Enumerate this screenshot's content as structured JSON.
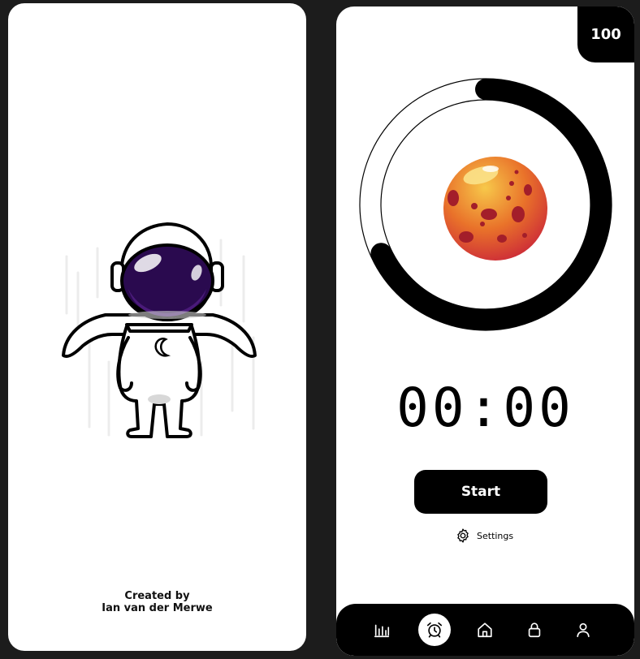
{
  "splash": {
    "credit_line1": "Created by",
    "credit_line2": "Ian van der Merwe",
    "illustration": "astronaut-with-cape"
  },
  "timer": {
    "score": "100",
    "progress": 0.68,
    "planet": "mars-planet",
    "time": "00:00",
    "start_label": "Start",
    "settings_label": "Settings"
  },
  "nav": {
    "items": [
      {
        "icon": "chart-icon",
        "active": false
      },
      {
        "icon": "alarm-clock-icon",
        "active": true
      },
      {
        "icon": "home-icon",
        "active": false
      },
      {
        "icon": "lock-icon",
        "active": false
      },
      {
        "icon": "user-icon",
        "active": false
      }
    ]
  },
  "colors": {
    "background": "#1c1c1c",
    "card": "#ffffff",
    "accent": "#000000",
    "visor": "#2a0a4f",
    "planet": "#e05a2a"
  }
}
